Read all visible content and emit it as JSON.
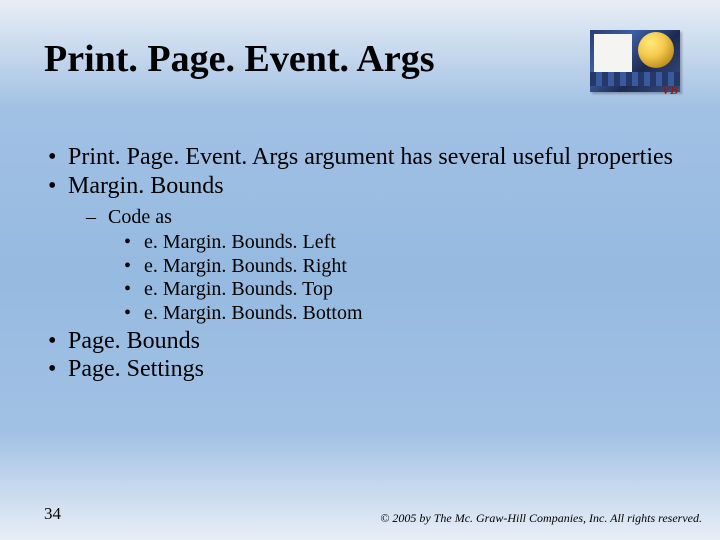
{
  "title": "Print. Page. Event. Args",
  "bullets": {
    "top1": "Print. Page. Event. Args argument has several useful properties",
    "top2": "Margin. Bounds",
    "codeAs": "Code as",
    "code1": "e. Margin. Bounds. Left",
    "code2": "e. Margin. Bounds. Right",
    "code3": "e. Margin. Bounds. Top",
    "code4": "e. Margin. Bounds. Bottom",
    "top3": "Page. Bounds",
    "top4": "Page. Settings"
  },
  "art": {
    "vb": "VB"
  },
  "pageNumber": "34",
  "copyright": "© 2005 by The Mc. Graw-Hill Companies, Inc. All rights reserved."
}
